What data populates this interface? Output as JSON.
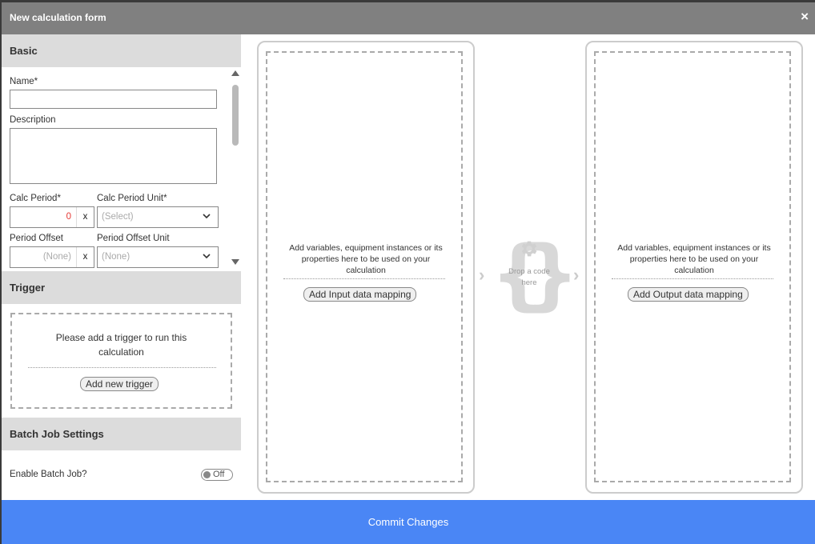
{
  "dialog": {
    "title": "New calculation form",
    "close": "×"
  },
  "basic": {
    "heading": "Basic",
    "name_label": "Name*",
    "name_value": "",
    "description_label": "Description",
    "description_value": "",
    "calc_period_label": "Calc Period*",
    "calc_period_value": "0",
    "calc_period_clear": "x",
    "calc_period_unit_label": "Calc Period Unit*",
    "calc_period_unit_placeholder": "(Select)",
    "period_offset_label": "Period Offset",
    "period_offset_value": "(None)",
    "period_offset_clear": "x",
    "period_offset_unit_label": "Period Offset Unit",
    "period_offset_unit_value": "(None)"
  },
  "trigger": {
    "heading": "Trigger",
    "message": "Please add a trigger to run this calculation",
    "add_button": "Add new trigger"
  },
  "batch": {
    "heading": "Batch Job Settings",
    "enable_label": "Enable Batch Job?",
    "toggle_text": "Off"
  },
  "input_panel": {
    "message": "Add variables, equipment instances or its properties here to be used on your calculation",
    "button": "Add Input data mapping"
  },
  "code": {
    "text": "Drop a code here"
  },
  "output_panel": {
    "message": "Add variables, equipment instances or its properties here to be used on your calculation",
    "button": "Add Output data mapping"
  },
  "footer": {
    "commit": "Commit Changes"
  },
  "colors": {
    "accent": "#4a86f5",
    "titlebar": "#808080",
    "section": "#dcdcdc",
    "error_value": "#e53935"
  }
}
